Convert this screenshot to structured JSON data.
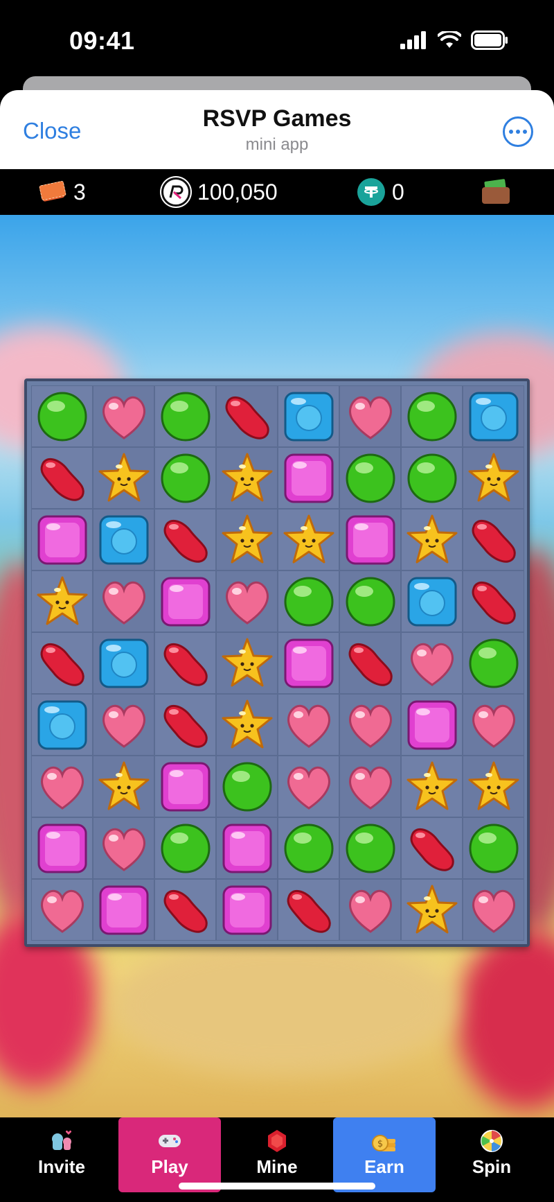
{
  "status_bar": {
    "time": "09:41"
  },
  "header": {
    "close_label": "Close",
    "title": "RSVP Games",
    "subtitle": "mini app"
  },
  "currency": {
    "tickets": "3",
    "points": "100,050",
    "usdt": "0"
  },
  "board": {
    "rows": [
      [
        "green",
        "heart",
        "green",
        "bean",
        "blue",
        "heart",
        "green",
        "blue"
      ],
      [
        "bean",
        "star",
        "green",
        "star",
        "pink",
        "green",
        "green",
        "star"
      ],
      [
        "pink",
        "blue",
        "bean",
        "star",
        "star",
        "pink",
        "star",
        "bean"
      ],
      [
        "star",
        "heart",
        "pink",
        "heart",
        "green",
        "green",
        "blue",
        "bean"
      ],
      [
        "bean",
        "blue",
        "bean",
        "star",
        "pink",
        "bean",
        "heart",
        "green"
      ],
      [
        "blue",
        "heart",
        "bean",
        "star",
        "heart",
        "heart",
        "pink",
        "heart"
      ],
      [
        "heart",
        "star",
        "pink",
        "green",
        "heart",
        "heart",
        "star",
        "star"
      ],
      [
        "pink",
        "heart",
        "green",
        "pink",
        "green",
        "green",
        "bean",
        "green"
      ],
      [
        "heart",
        "pink",
        "bean",
        "pink",
        "bean",
        "heart",
        "star",
        "heart"
      ]
    ],
    "colors": {
      "green": "#3cc21e",
      "heart": "#f06a93",
      "bean": "#e0203a",
      "blue": "#2aa5e6",
      "pink": "#e040d0",
      "star": "#f7c21e"
    }
  },
  "nav": {
    "items": [
      {
        "label": "Invite",
        "icon": "invite-icon"
      },
      {
        "label": "Play",
        "icon": "gamepad-icon"
      },
      {
        "label": "Mine",
        "icon": "gem-icon"
      },
      {
        "label": "Earn",
        "icon": "coins-icon"
      },
      {
        "label": "Spin",
        "icon": "wheel-icon"
      }
    ],
    "active_colors": {
      "play": "#d9287a",
      "earn": "#3f80f0"
    }
  }
}
